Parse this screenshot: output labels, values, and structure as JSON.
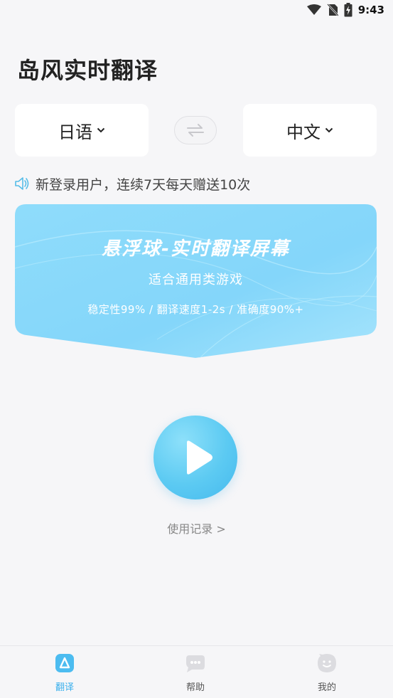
{
  "status_bar": {
    "time": "9:43"
  },
  "app_title": "岛风实时翻译",
  "languages": {
    "source": "日语",
    "target": "中文"
  },
  "notice": {
    "icon": "speaker-icon",
    "text": "新登录用户，连续7天每天赠送10次"
  },
  "banner": {
    "title": "悬浮球-实时翻译屏幕",
    "subtitle": "适合通用类游戏",
    "stats": "稳定性99% / 翻译速度1-2s / 准确度90%+"
  },
  "history_link": "使用记录 >",
  "tabs": [
    {
      "label": "翻译",
      "icon": "translate-tab-icon",
      "active": true
    },
    {
      "label": "帮助",
      "icon": "chat-bubble-icon",
      "active": false
    },
    {
      "label": "我的",
      "icon": "smiley-face-icon",
      "active": false
    }
  ],
  "colors": {
    "accent": "#3bb0ec",
    "banner": "#8adcfb",
    "background": "#f6f6f8"
  }
}
